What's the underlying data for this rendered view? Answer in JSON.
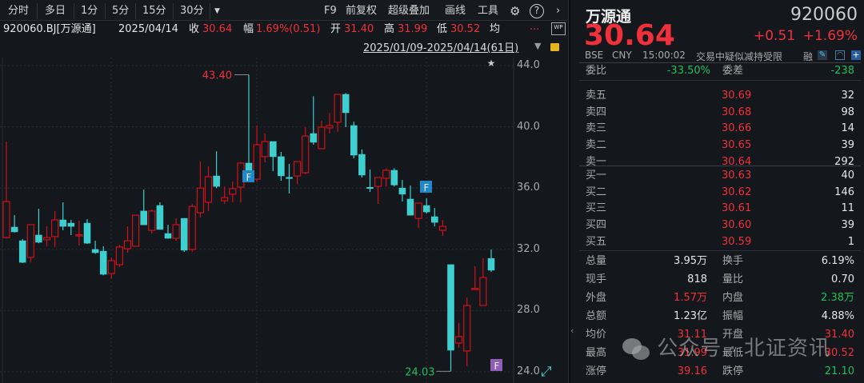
{
  "toolbar": {
    "periods": [
      "分时",
      "多日",
      "1分",
      "5分",
      "15分",
      "30分"
    ],
    "more_icon": "dropdown-icon",
    "right": [
      "F9",
      "前复权",
      "超级叠加",
      "画线",
      "工具"
    ],
    "settings_icon": "gear-icon",
    "help_icon": "help-icon",
    "next_icon": "chevron-right-icon"
  },
  "info": {
    "code": "920060.BJ[万源通]",
    "date": "2025/04/14",
    "close_label": "收",
    "close": "30.64",
    "amp_label": "幅",
    "amp": "1.69%(0.51)",
    "open_label": "开",
    "open": "31.40",
    "high_label": "高",
    "high": "31.99",
    "low_label": "低",
    "low": "30.52",
    "avg_label": "均",
    "more": "...",
    "wp": "WP"
  },
  "range": {
    "text": "2025/01/09-2025/04/14(61日)"
  },
  "chart_data": {
    "type": "candlestick",
    "ylim": [
      24,
      44
    ],
    "yticks": [
      "44.0",
      "40.0",
      "36.0",
      "32.0",
      "28.0",
      "24.0"
    ],
    "ytick_values": [
      44,
      40,
      36,
      32,
      28,
      24
    ],
    "max_label": "43.40",
    "min_label": "24.03",
    "markers": [
      {
        "label": "F",
        "index": 30,
        "color": "#1e88c8"
      },
      {
        "label": "F",
        "index": 52,
        "color": "#1e88c8"
      },
      {
        "label": "F",
        "index": 60,
        "color": "#8e5fb5"
      }
    ],
    "up_color": "#d0101a",
    "down_color": "#3ecfd0",
    "candles": [
      [
        32.77,
        39.04,
        32.7,
        35.12
      ],
      [
        33.45,
        34.23,
        33.1,
        33.14
      ],
      [
        32.56,
        32.67,
        31.1,
        31.15
      ],
      [
        31.47,
        33.61,
        31.15,
        33.61
      ],
      [
        32.93,
        34.65,
        32.4,
        32.46
      ],
      [
        32.62,
        33.5,
        32.2,
        32.77
      ],
      [
        32.83,
        34.5,
        32.15,
        33.92
      ],
      [
        33.92,
        35.07,
        33.24,
        33.5
      ],
      [
        33.71,
        33.92,
        32.93,
        33.5
      ],
      [
        32.9,
        33.87,
        32.25,
        32.95
      ],
      [
        33.71,
        33.97,
        32.35,
        32.4
      ],
      [
        31.99,
        32.56,
        31.7,
        31.78
      ],
      [
        31.88,
        32.2,
        30.3,
        30.37
      ],
      [
        30.42,
        31.47,
        30.1,
        31.26
      ],
      [
        31.0,
        32.3,
        30.84,
        32.15
      ],
      [
        32.04,
        33.5,
        31.78,
        32.56
      ],
      [
        32.2,
        34.23,
        32.2,
        34.23
      ],
      [
        34.5,
        35.9,
        33.6,
        33.6
      ],
      [
        33.24,
        34.6,
        33.03,
        34.5
      ],
      [
        34.86,
        35.07,
        33.3,
        33.3
      ],
      [
        33.03,
        33.6,
        32.7,
        32.72
      ],
      [
        32.72,
        34.02,
        32.56,
        33.61
      ],
      [
        34.02,
        34.02,
        31.83,
        31.94
      ],
      [
        31.99,
        34.96,
        31.83,
        34.8
      ],
      [
        34.39,
        37.73,
        34.08,
        36.0
      ],
      [
        35.07,
        37.42,
        34.5,
        36.74
      ],
      [
        36.79,
        38.4,
        36.0,
        36.11
      ],
      [
        35.17,
        36.11,
        34.96,
        35.38
      ],
      [
        35.6,
        36.43,
        35.07,
        35.96
      ],
      [
        36.06,
        37.7,
        35.07,
        37.63
      ],
      [
        37.63,
        43.4,
        36.5,
        36.7
      ],
      [
        36.58,
        40.08,
        36.43,
        38.83
      ],
      [
        38.05,
        39.56,
        37.68,
        39.04
      ],
      [
        39.04,
        39.04,
        37.1,
        38.05
      ],
      [
        38.05,
        38.36,
        36.48,
        36.8
      ],
      [
        36.7,
        37.58,
        35.65,
        36.63
      ],
      [
        36.79,
        37.73,
        36.27,
        37.73
      ],
      [
        37.0,
        39.98,
        36.9,
        39.4
      ],
      [
        39.56,
        42.0,
        38.83,
        38.99
      ],
      [
        38.57,
        40.4,
        38.57,
        39.98
      ],
      [
        39.93,
        40.9,
        39.56,
        40.08
      ],
      [
        40.3,
        42.12,
        39.67,
        42.12
      ],
      [
        42.12,
        42.2,
        39.98,
        40.92
      ],
      [
        40.08,
        40.34,
        37.94,
        38.15
      ],
      [
        38.2,
        38.52,
        36.69,
        36.85
      ],
      [
        36.05,
        37.21,
        35.75,
        36.0
      ],
      [
        36.11,
        36.69,
        34.96,
        36.69
      ],
      [
        36.64,
        37.3,
        36.1,
        37.16
      ],
      [
        37.16,
        37.3,
        36.1,
        36.2
      ],
      [
        36.0,
        36.53,
        35.12,
        35.6
      ],
      [
        35.28,
        36.17,
        34.2,
        34.23
      ],
      [
        34.02,
        35.02,
        33.4,
        35.02
      ],
      [
        34.86,
        35.33,
        34.34,
        34.44
      ],
      [
        34.13,
        34.7,
        33.5,
        33.76
      ],
      [
        33.24,
        33.92,
        32.88,
        33.5
      ],
      [
        31.0,
        31.0,
        24.03,
        25.41
      ],
      [
        25.88,
        27.2,
        25.57,
        26.3
      ],
      [
        25.36,
        28.85,
        24.36,
        28.33
      ],
      [
        29.4,
        30.9,
        29.4,
        29.45
      ],
      [
        28.33,
        31.42,
        28.3,
        30.16
      ],
      [
        31.4,
        31.99,
        30.52,
        30.64
      ]
    ]
  },
  "quote": {
    "name": "万源通",
    "code": "920060",
    "price": "30.64",
    "change": "+0.51",
    "pct": "+1.69%",
    "exchange": "BSE",
    "currency": "CNY",
    "time": "15:00:02",
    "notice": "交易中疑似减持受限",
    "rong": "融"
  },
  "ratio": {
    "wb_label": "委比",
    "wb": "-33.50%",
    "wc_label": "委差",
    "wc": "-238"
  },
  "asks": [
    {
      "label": "卖五",
      "price": "30.69",
      "vol": "32"
    },
    {
      "label": "卖四",
      "price": "30.68",
      "vol": "98"
    },
    {
      "label": "卖三",
      "price": "30.66",
      "vol": "14"
    },
    {
      "label": "卖二",
      "price": "30.65",
      "vol": "39"
    },
    {
      "label": "卖一",
      "price": "30.64",
      "vol": "292"
    }
  ],
  "bids": [
    {
      "label": "买一",
      "price": "30.63",
      "vol": "40"
    },
    {
      "label": "买二",
      "price": "30.62",
      "vol": "146"
    },
    {
      "label": "买三",
      "price": "30.61",
      "vol": "11"
    },
    {
      "label": "买四",
      "price": "30.60",
      "vol": "39"
    },
    {
      "label": "买五",
      "price": "30.59",
      "vol": "1"
    }
  ],
  "stats": [
    {
      "l1": "总量",
      "v1": "3.95万",
      "c1": "white",
      "l2": "换手",
      "v2": "6.19%",
      "c2": "white"
    },
    {
      "l1": "现手",
      "v1": "818",
      "c1": "white",
      "l2": "量比",
      "v2": "0.70",
      "c2": "white"
    },
    {
      "l1": "外盘",
      "v1": "1.57万",
      "c1": "red",
      "l2": "内盘",
      "v2": "2.38万",
      "c2": "green"
    },
    {
      "l1": "总额",
      "v1": "1.23亿",
      "c1": "white",
      "l2": "振幅",
      "v2": "4.88%",
      "c2": "white"
    },
    {
      "l1": "均价",
      "v1": "31.11",
      "c1": "red",
      "l2": "开盘",
      "v2": "31.40",
      "c2": "red"
    },
    {
      "l1": "最高",
      "v1": "31.99",
      "c1": "red",
      "l2": "最低",
      "v2": "30.52",
      "c2": "red"
    },
    {
      "l1": "涨停",
      "v1": "39.16",
      "c1": "red",
      "l2": "跌停",
      "v2": "21.10",
      "c2": "green"
    }
  ],
  "watermark": {
    "text": "公众号 · 北证资讯"
  }
}
